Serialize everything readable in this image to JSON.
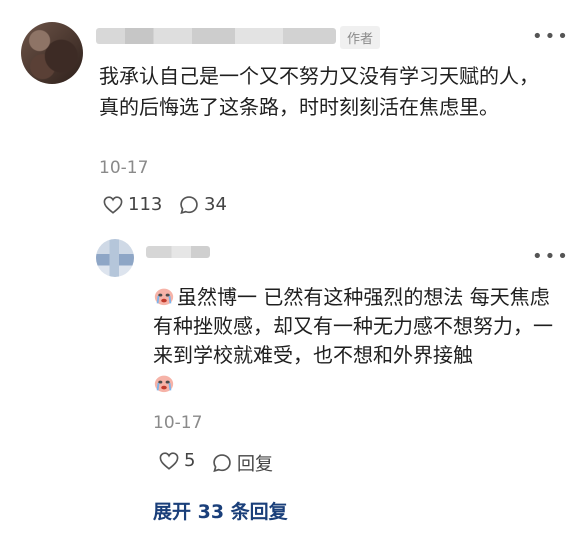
{
  "comment": {
    "author_badge": "作者",
    "text": "我承认自己是一个又不努力又没有学习天赋的人，真的后悔选了这条路，时时刻刻活在焦虑里。",
    "date": "10-17",
    "likes": "113",
    "comments": "34"
  },
  "reply": {
    "text": "虽然博一 已然有这种强烈的想法 每天焦虑 有种挫败感，却又有一种无力感不想努力，一来到学校就难受，也不想和外界接触",
    "date": "10-17",
    "likes": "5",
    "reply_label": "回复"
  },
  "expand": {
    "label": "展开 33 条回复"
  },
  "icons": {
    "more": "more-dots-icon",
    "like": "heart-icon",
    "comment": "comment-bubble-icon",
    "emoji": "crying-face-emoji-icon"
  },
  "colors": {
    "link": "#1a3f7a",
    "muted": "#8a8a8a"
  }
}
